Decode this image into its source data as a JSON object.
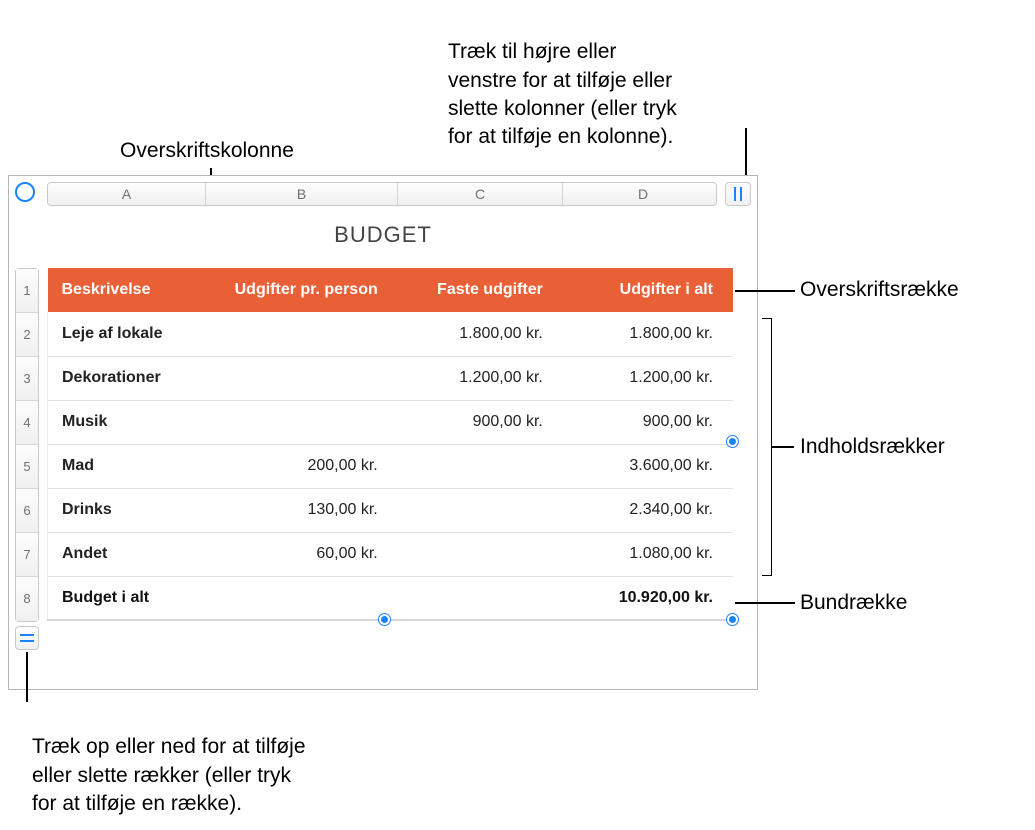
{
  "callouts": {
    "top_left": "Overskriftskolonne",
    "top_right": "Træk til højre eller\nvenstre for at tilføje eller\nslette kolonner (eller tryk\nfor at tilføje en kolonne).",
    "right_header": "Overskriftsrække",
    "right_body": "Indholdsrækker",
    "right_footer": "Bundrække",
    "bottom": "Træk op eller ned for at tilføje\neller slette rækker (eller tryk\nfor at tilføje en række)."
  },
  "col_letters": [
    "A",
    "B",
    "C",
    "D"
  ],
  "row_numbers": [
    "1",
    "2",
    "3",
    "4",
    "5",
    "6",
    "7",
    "8"
  ],
  "title": "BUDGET",
  "headers": {
    "c0": "Beskrivelse",
    "c1": "Udgifter pr. person",
    "c2": "Faste udgifter",
    "c3": "Udgifter i alt"
  },
  "rows": [
    {
      "desc": "Leje af lokale",
      "per": "",
      "fixed": "1.800,00 kr.",
      "total": "1.800,00 kr."
    },
    {
      "desc": "Dekorationer",
      "per": "",
      "fixed": "1.200,00 kr.",
      "total": "1.200,00 kr."
    },
    {
      "desc": "Musik",
      "per": "",
      "fixed": "900,00 kr.",
      "total": "900,00 kr."
    },
    {
      "desc": "Mad",
      "per": "200,00 kr.",
      "fixed": "",
      "total": "3.600,00 kr."
    },
    {
      "desc": "Drinks",
      "per": "130,00 kr.",
      "fixed": "",
      "total": "2.340,00 kr."
    },
    {
      "desc": "Andet",
      "per": "60,00 kr.",
      "fixed": "",
      "total": "1.080,00 kr."
    }
  ],
  "footer": {
    "desc": "Budget i alt",
    "per": "",
    "fixed": "",
    "total": "10.920,00 kr."
  }
}
